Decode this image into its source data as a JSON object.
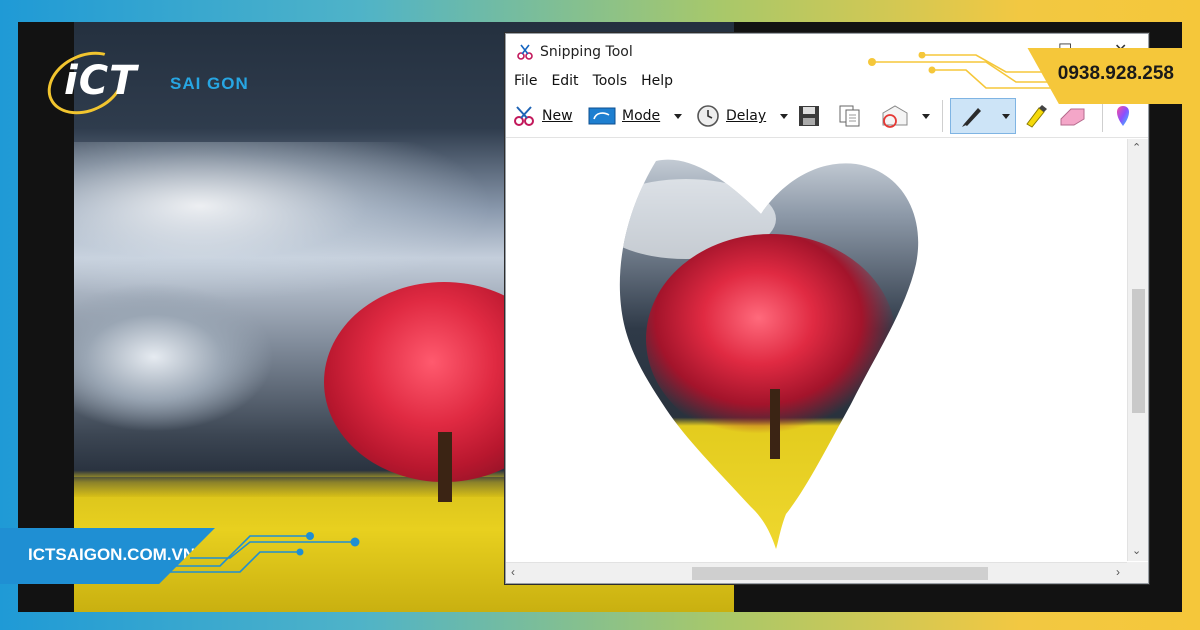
{
  "brand": {
    "logo_main": "iCT",
    "logo_sub": "SAI GON",
    "website": "ICTSAIGON.COM.VN",
    "phone": "0938.928.258"
  },
  "window": {
    "title": "Snipping Tool",
    "controls": {
      "maximize": "☐",
      "close": "✕"
    },
    "menu": [
      "File",
      "Edit",
      "Tools",
      "Help"
    ],
    "toolbar": {
      "new_label": "New",
      "mode_label": "Mode",
      "delay_label": "Delay"
    }
  },
  "colors": {
    "accent_blue": "#1f8fd3",
    "accent_yellow": "#f5c73a",
    "tree_red": "#e02a42",
    "field_yellow": "#e8d01f"
  },
  "icons": [
    "scissors-icon",
    "mode-icon",
    "clock-icon",
    "save-icon",
    "copy-icon",
    "send-icon",
    "pen-icon",
    "highlighter-icon",
    "eraser-icon",
    "paint3d-icon"
  ]
}
